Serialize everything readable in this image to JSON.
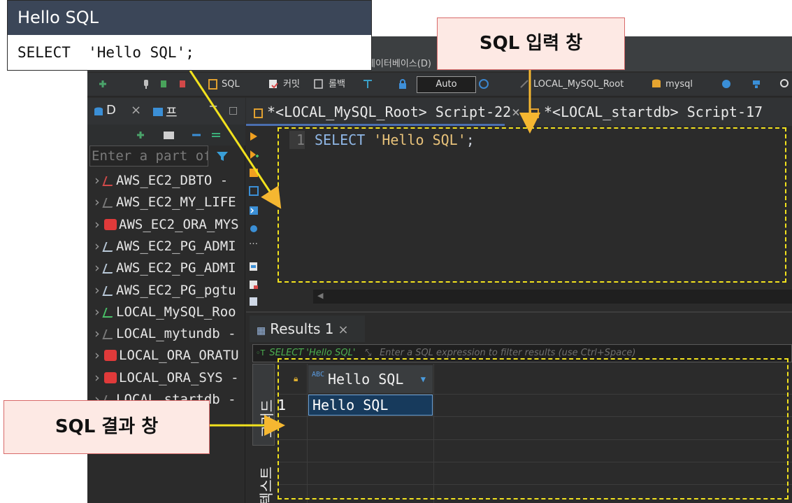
{
  "menu": {
    "database_label": "데이터베이스(D)"
  },
  "toolbar": {
    "sql_label": "SQL",
    "commit_label": "커밋",
    "rollback_label": "롤백",
    "auto_label": "Auto",
    "connection_label": "LOCAL_MySQL_Root",
    "schema_label": "mysql"
  },
  "left_panel": {
    "tab1_label": "D",
    "tab2_label": "프",
    "filter_placeholder": "Enter a part of",
    "items": [
      {
        "label": "AWS_EC2_DBTO  -",
        "icon": "db-disconnected-icon"
      },
      {
        "label": "AWS_EC2_MY_LIFE",
        "icon": "db-mysql-icon"
      },
      {
        "label": "AWS_EC2_ORA_MYS",
        "icon": "db-oracle-icon"
      },
      {
        "label": "AWS_EC2_PG_ADMI",
        "icon": "db-postgres-icon"
      },
      {
        "label": "AWS_EC2_PG_ADMI",
        "icon": "db-postgres-icon"
      },
      {
        "label": "AWS_EC2_PG_pgtu",
        "icon": "db-postgres-icon"
      },
      {
        "label": "LOCAL_MySQL_Roo",
        "icon": "db-connected-icon"
      },
      {
        "label": "LOCAL_mytundb  -",
        "icon": "db-mysql-icon"
      },
      {
        "label": "LOCAL_ORA_ORATU",
        "icon": "db-oracle-icon"
      },
      {
        "label": "LOCAL_ORA_SYS  -",
        "icon": "db-oracle-icon"
      },
      {
        "label": "LOCAL_startdb  -",
        "icon": "db-mysql-icon"
      }
    ]
  },
  "editor": {
    "tab1": "*<LOCAL_MySQL_Root> Script-22",
    "tab2": "*<LOCAL_startdb> Script-17",
    "line_number": "1",
    "code_keyword": "SELECT",
    "code_string": "'Hello SQL'",
    "code_end": ";"
  },
  "results": {
    "tab_label": "Results 1",
    "filter_query": "SELECT 'Hello SQL'",
    "filter_placeholder": "Enter a SQL expression to filter results (use Ctrl+Space)",
    "column_header": "Hello SQL",
    "rows": [
      {
        "num": "1",
        "value": "Hello SQL"
      }
    ],
    "vtab_grid": "그리드",
    "vtab_text": "텍스트"
  },
  "annotations": {
    "hello_title": "Hello SQL",
    "hello_query": "SELECT  'Hello SQL';",
    "sql_input_label": "SQL 입력 창",
    "sql_result_label": "SQL 결과 창",
    "highlight_color": "#f2e21d",
    "arrow_color": "#f5b731"
  }
}
